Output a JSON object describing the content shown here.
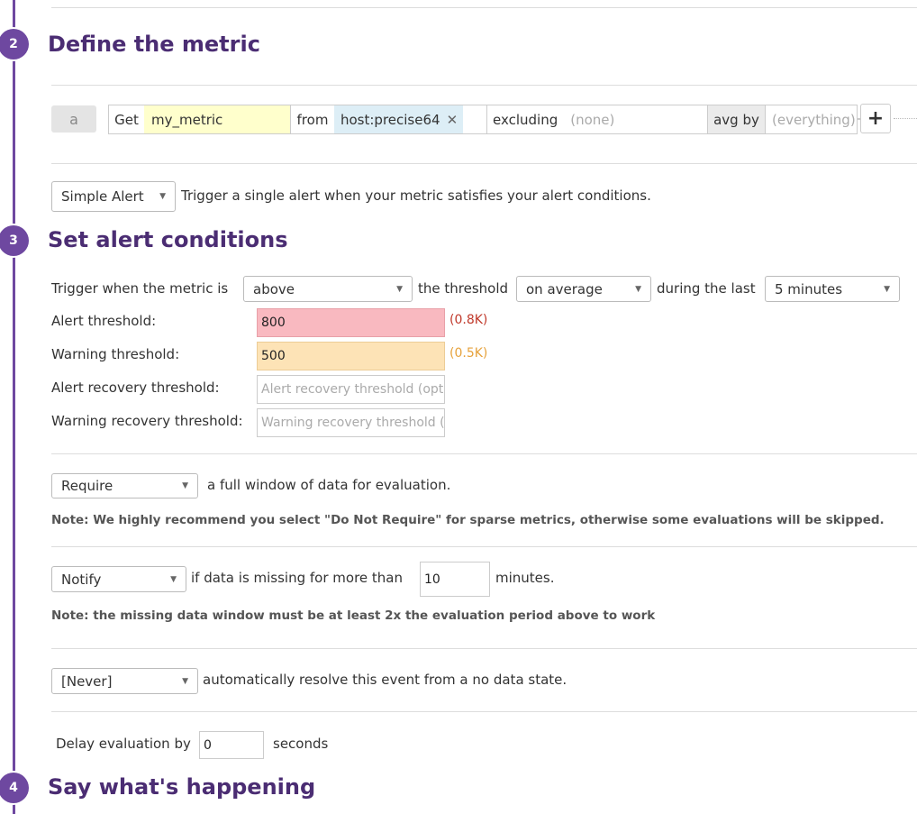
{
  "steps": [
    {
      "number": "2",
      "title": "Define the metric"
    },
    {
      "number": "3",
      "title": "Set alert conditions"
    },
    {
      "number": "4",
      "title": "Say what's happening"
    }
  ],
  "query": {
    "letter": "a",
    "get_label": "Get",
    "metric": "my_metric",
    "from_label": "from",
    "from_tag": "host:precise64",
    "remove_glyph": "✕",
    "excluding_label": "excluding",
    "excluding_value": "(none)",
    "avg_by_label": "avg by",
    "avg_by_value": "(everything)",
    "add_glyph": "+"
  },
  "alert_type": {
    "select": "Simple Alert",
    "description": "Trigger a single alert when your metric satisfies your alert conditions."
  },
  "conditions": {
    "trigger_prefix": "Trigger when the metric is",
    "comparator": "above",
    "threshold_label": "the threshold",
    "aggregation": "on average",
    "during_label": "during the last",
    "timeframe": "5 minutes",
    "alert_threshold_label": "Alert threshold:",
    "alert_threshold_value": "800",
    "alert_threshold_hint": "(0.8K)",
    "warning_threshold_label": "Warning threshold:",
    "warning_threshold_value": "500",
    "warning_threshold_hint": "(0.5K)",
    "alert_recovery_label": "Alert recovery threshold:",
    "alert_recovery_placeholder": "Alert recovery threshold (optional)",
    "warning_recovery_label": "Warning recovery threshold:",
    "warning_recovery_placeholder": "Warning recovery threshold (optional)"
  },
  "full_window": {
    "select": "Require",
    "text": "a full window of data for evaluation.",
    "note": "Note: We highly recommend you select \"Do Not Require\" for sparse metrics, otherwise some evaluations will be skipped."
  },
  "missing_data": {
    "select": "Notify",
    "text_before": "if data is missing for more than",
    "minutes_value": "10",
    "text_after": "minutes.",
    "note": "Note: the missing data window must be at least 2x the evaluation period above to work"
  },
  "resolve": {
    "select": "[Never]",
    "text": "automatically resolve this event from a no data state."
  },
  "delay": {
    "label": "Delay evaluation by",
    "value": "0",
    "unit": "seconds"
  },
  "colors": {
    "accent": "#6e48a0",
    "heading": "#4b2d73",
    "alert_bg": "#f9b9c0",
    "warning_bg": "#fde3b6",
    "alert_hint": "#c0392b",
    "warning_hint": "#e6a23c",
    "metric_bg": "#ffffcc",
    "tag_bg": "#ddeef6"
  }
}
